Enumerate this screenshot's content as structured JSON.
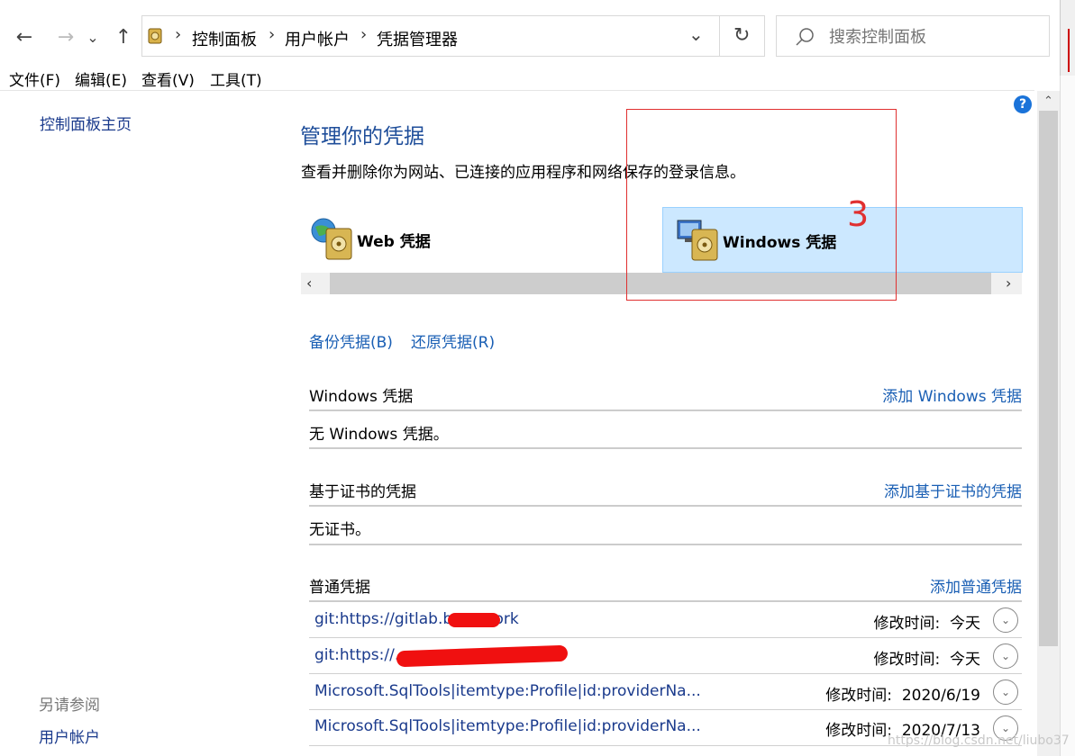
{
  "nav": {
    "back": "←",
    "forward": "→",
    "recent": "⌄",
    "up": "↑"
  },
  "address": {
    "crumbs": [
      "控制面板",
      "用户帐户",
      "凭据管理器"
    ],
    "separator": "›",
    "dropdown": "⌄",
    "refresh": "↻"
  },
  "search": {
    "placeholder": "搜索控制面板"
  },
  "menubar": [
    "文件(F)",
    "编辑(E)",
    "查看(V)",
    "工具(T)"
  ],
  "sidebar": {
    "home": "控制面板主页",
    "see_also_heading": "另请参阅",
    "see_also_link": "用户帐户"
  },
  "main": {
    "title": "管理你的凭据",
    "description": "查看并删除你为网站、已连接的应用程序和网络保存的登录信息。",
    "tiles": [
      {
        "label": "Web 凭据",
        "icon": "web-vault-icon",
        "selected": false
      },
      {
        "label": "Windows 凭据",
        "icon": "windows-vault-icon",
        "selected": true
      }
    ],
    "annotation_number": "3",
    "backup_link": "备份凭据(B)",
    "restore_link": "还原凭据(R)",
    "sections": {
      "windows": {
        "heading": "Windows 凭据",
        "add": "添加 Windows 凭据",
        "empty": "无 Windows 凭据。"
      },
      "cert": {
        "heading": "基于证书的凭据",
        "add": "添加基于证书的凭据",
        "empty": "无证书。"
      },
      "generic": {
        "heading": "普通凭据",
        "add": "添加普通凭据"
      }
    },
    "credentials": [
      {
        "name": "git:https://gitlab.b......work",
        "modified_label": "修改时间:",
        "modified": "今天"
      },
      {
        "name": "git:https://............work",
        "modified_label": "修改时间:",
        "modified": "今天"
      },
      {
        "name": "Microsoft.SqlTools|itemtype:Profile|id:providerNa...",
        "modified_label": "修改时间:",
        "modified": "2020/6/19"
      },
      {
        "name": "Microsoft.SqlTools|itemtype:Profile|id:providerNa...",
        "modified_label": "修改时间:",
        "modified": "2020/7/13"
      }
    ]
  },
  "help_icon": "?",
  "watermark": "https://blog.csdn.net/liubo37",
  "colors": {
    "link": "#1a5fb4",
    "title": "#1f4e9a",
    "selected_tile": "#cce8ff",
    "annotation_box": "#e03030"
  }
}
